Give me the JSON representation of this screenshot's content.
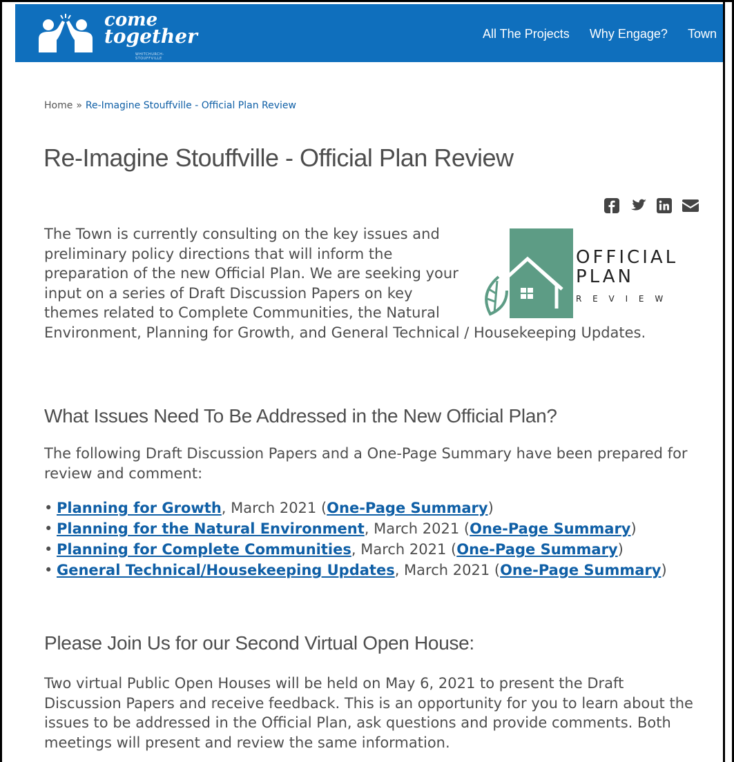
{
  "header": {
    "logo_line1": "come",
    "logo_line2": "together",
    "logo_sub": "WHITCHURCH-STOUFFVILLE",
    "nav": [
      "All The Projects",
      "Why Engage?",
      "Town"
    ]
  },
  "breadcrumb": {
    "home": "Home",
    "separator": "»",
    "current": "Re-Imagine Stouffville - Official Plan Review"
  },
  "page_title": "Re-Imagine Stouffville - Official Plan Review",
  "share": [
    "facebook-icon",
    "twitter-icon",
    "linkedin-icon",
    "email-icon"
  ],
  "intro": {
    "text": "The Town is currently consulting on the key issues and preliminary policy directions that will inform the preparation of the new Official Plan. We are seeking your input on a series of Draft Discussion Papers on key themes related to Complete Communities, the Natural Environment, Planning for Growth, and General Technical / Housekeeping Updates.",
    "logo_words": [
      "OFFICIAL",
      "PLAN",
      "R E V I E W"
    ]
  },
  "section1": {
    "heading": "What Issues Need To Be Addressed in the New Official Plan?",
    "text": "The following Draft Discussion Papers and a One-Page Summary have been prepared for review and comment:",
    "items": [
      {
        "link": "Planning for Growth",
        "date": ", March 2021 (",
        "summary": "One-Page Summary",
        "close": ")"
      },
      {
        "link": "Planning for the Natural Environment",
        "date": ", March 2021 (",
        "summary": "One-Page Summary",
        "close": ")"
      },
      {
        "link": "Planning for Complete Communities",
        "date": ", March 2021 (",
        "summary": "One-Page Summary",
        "close": ")"
      },
      {
        "link": "General Technical/Housekeeping Updates",
        "date": ", March 2021 (",
        "summary": "One-Page Summary",
        "close": ")"
      }
    ]
  },
  "section2": {
    "heading": "Please Join Us for our Second Virtual Open House:",
    "text": "Two virtual Public Open Houses will be held on May 6, 2021 to present the Draft Discussion Papers and receive feedback. This is an opportunity for you to learn about the issues to be addressed in the Official Plan, ask questions and provide comments. Both meetings will present and review the same information."
  },
  "colors": {
    "header_bg": "#0f6fbd",
    "link": "#0f5fa6",
    "logo_green": "#5d9c85"
  }
}
